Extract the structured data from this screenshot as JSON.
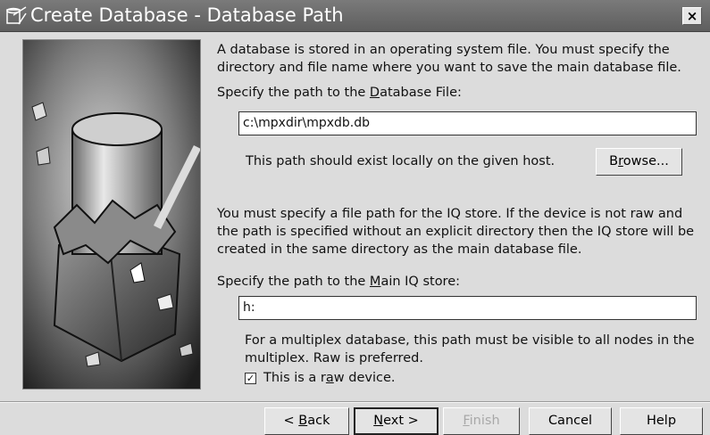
{
  "window": {
    "title": "Create Database - Database Path",
    "close_label": "×"
  },
  "intro": {
    "line1": "A database is stored in an operating system file. You must specify the",
    "line2": "directory and file name where you want to save the main database file."
  },
  "db_file": {
    "label_pre": "Specify the path to the ",
    "label_mnemonic": "D",
    "label_post": "atabase File:",
    "value": "c:\\mpxdir\\mpxdb.db",
    "note": "This path should exist locally on the given host.",
    "browse_pre": "B",
    "browse_mnemonic": "r",
    "browse_post": "owse..."
  },
  "iq_info": {
    "line1": "You must specify a file path for the IQ store.  If the device is not raw and",
    "line2": "the path is specified without an explicit directory then the IQ store will be",
    "line3": "created in the same directory as the main database file."
  },
  "main_iq": {
    "label_pre": "Specify the path to the ",
    "label_mnemonic": "M",
    "label_post": "ain IQ store:",
    "value": "h:",
    "note1": "For a multiplex database, this path must be visible to all nodes in the",
    "note2": "multiplex.  Raw is preferred."
  },
  "raw_device": {
    "checked": true,
    "check_glyph": "✓",
    "label_pre": "This is a r",
    "label_mnemonic": "a",
    "label_post": "w device."
  },
  "buttons": {
    "back_pre": "< ",
    "back_mnemonic": "B",
    "back_post": "ack",
    "next_mnemonic": "N",
    "next_post": "ext >",
    "finish_mnemonic": "F",
    "finish_post": "inish",
    "cancel": "Cancel",
    "help": "Help"
  }
}
